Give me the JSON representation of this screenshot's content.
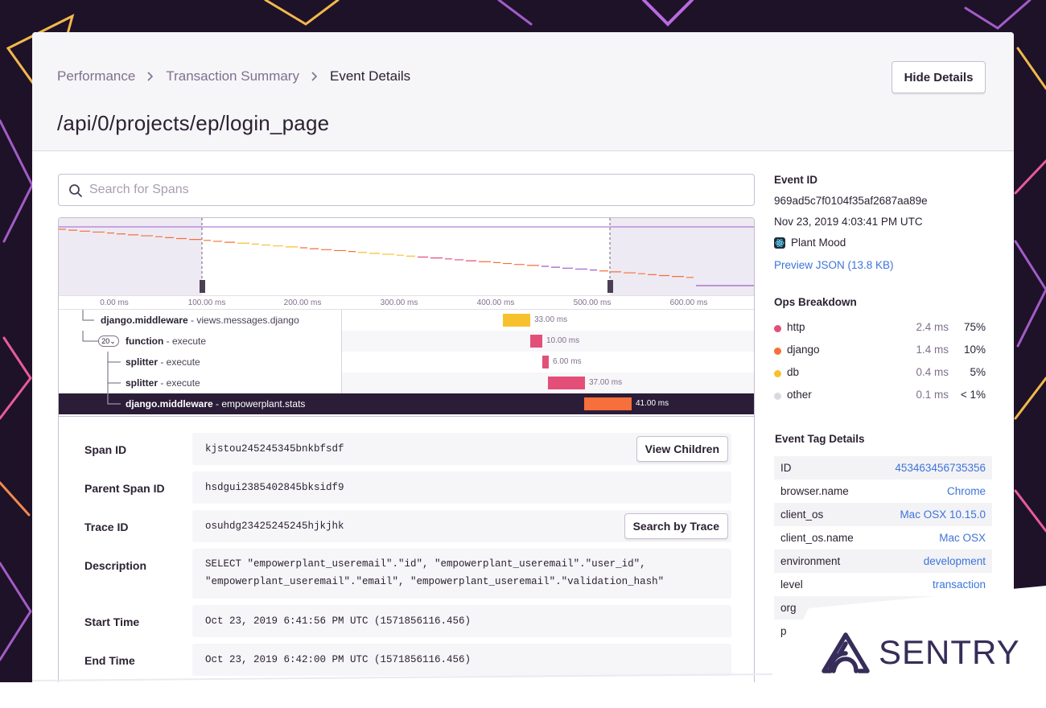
{
  "breadcrumb": {
    "items": [
      "Performance",
      "Transaction Summary"
    ],
    "current": "Event Details"
  },
  "page_title": "/api/0/projects/ep/login_page",
  "hide_details_label": "Hide Details",
  "search": {
    "placeholder": "Search for Spans",
    "value": ""
  },
  "timeline": {
    "ticks": [
      "0.00 ms",
      "100.00 ms",
      "200.00 ms",
      "300.00 ms",
      "400.00 ms",
      "500.00 ms",
      "600.00 ms"
    ]
  },
  "spans": [
    {
      "op": "django.middleware",
      "desc": " - views.messages.django",
      "duration": "33.00 ms",
      "color": "#f7c12e"
    },
    {
      "op": "function",
      "desc": " - execute",
      "duration": "10.00 ms",
      "color": "#e34f79",
      "child_count": "20"
    },
    {
      "op": "splitter",
      "desc": " - execute",
      "duration": "6.00 ms",
      "color": "#e34f79"
    },
    {
      "op": "splitter",
      "desc": " - execute",
      "duration": "37.00 ms",
      "color": "#e34f79"
    },
    {
      "op": "django.middleware",
      "desc": " - empowerplant.stats",
      "duration": "41.00 ms",
      "color": "#f76f3b",
      "selected": true
    }
  ],
  "span_details": {
    "span_id": {
      "label": "Span ID",
      "value": "kjstou245245345bnkbfsdf",
      "button": "View Children"
    },
    "parent_span_id": {
      "label": "Parent Span ID",
      "value": "hsdgui2385402845bksidf9"
    },
    "trace_id": {
      "label": "Trace ID",
      "value": "osuhdg23425245245hjkjhk",
      "button": "Search by Trace"
    },
    "description": {
      "label": "Description",
      "line1": "SELECT \"empowerplant_useremail\".\"id\", \"empowerplant_useremail\".\"user_id\",",
      "line2": "\"empowerplant_useremail\".\"email\", \"empowerplant_useremail\".\"validation_hash\""
    },
    "start_time": {
      "label": "Start Time",
      "value": "Oct 23, 2019 6:41:56 PM UTC (1571856116.456)"
    },
    "end_time": {
      "label": "End Time",
      "value": "Oct 23, 2019 6:42:00 PM UTC (1571856116.456)"
    }
  },
  "event": {
    "heading": "Event ID",
    "id": "969ad5c7f0104f35af2687aa89e",
    "date": "Nov 23, 2019 4:03:41 PM UTC",
    "project": "Plant Mood",
    "preview_link": "Preview JSON (13.8 KB)"
  },
  "ops_breakdown": {
    "heading": "Ops Breakdown",
    "items": [
      {
        "name": "http",
        "time": "2.4 ms",
        "percent": "75%",
        "color": "#e34f79"
      },
      {
        "name": "django",
        "time": "1.4 ms",
        "percent": "10%",
        "color": "#f76f3b"
      },
      {
        "name": "db",
        "time": "0.4 ms",
        "percent": "5%",
        "color": "#f7c12e"
      },
      {
        "name": "other",
        "time": "0.1 ms",
        "percent": "< 1%",
        "color": "#dcd8e0"
      }
    ]
  },
  "tags": {
    "heading": "Event Tag Details",
    "items": [
      {
        "key": "ID",
        "value": "453463456735356"
      },
      {
        "key": "browser.name",
        "value": "Chrome"
      },
      {
        "key": "client_os",
        "value": "Mac OSX 10.15.0"
      },
      {
        "key": "client_os.name",
        "value": "Mac OSX"
      },
      {
        "key": "environment",
        "value": "development"
      },
      {
        "key": "level",
        "value": "transaction"
      },
      {
        "key": "org",
        "value": ""
      },
      {
        "key": "p",
        "value": ""
      }
    ]
  },
  "brand": {
    "logo_text": "SENTRY",
    "color": "#362d59"
  }
}
